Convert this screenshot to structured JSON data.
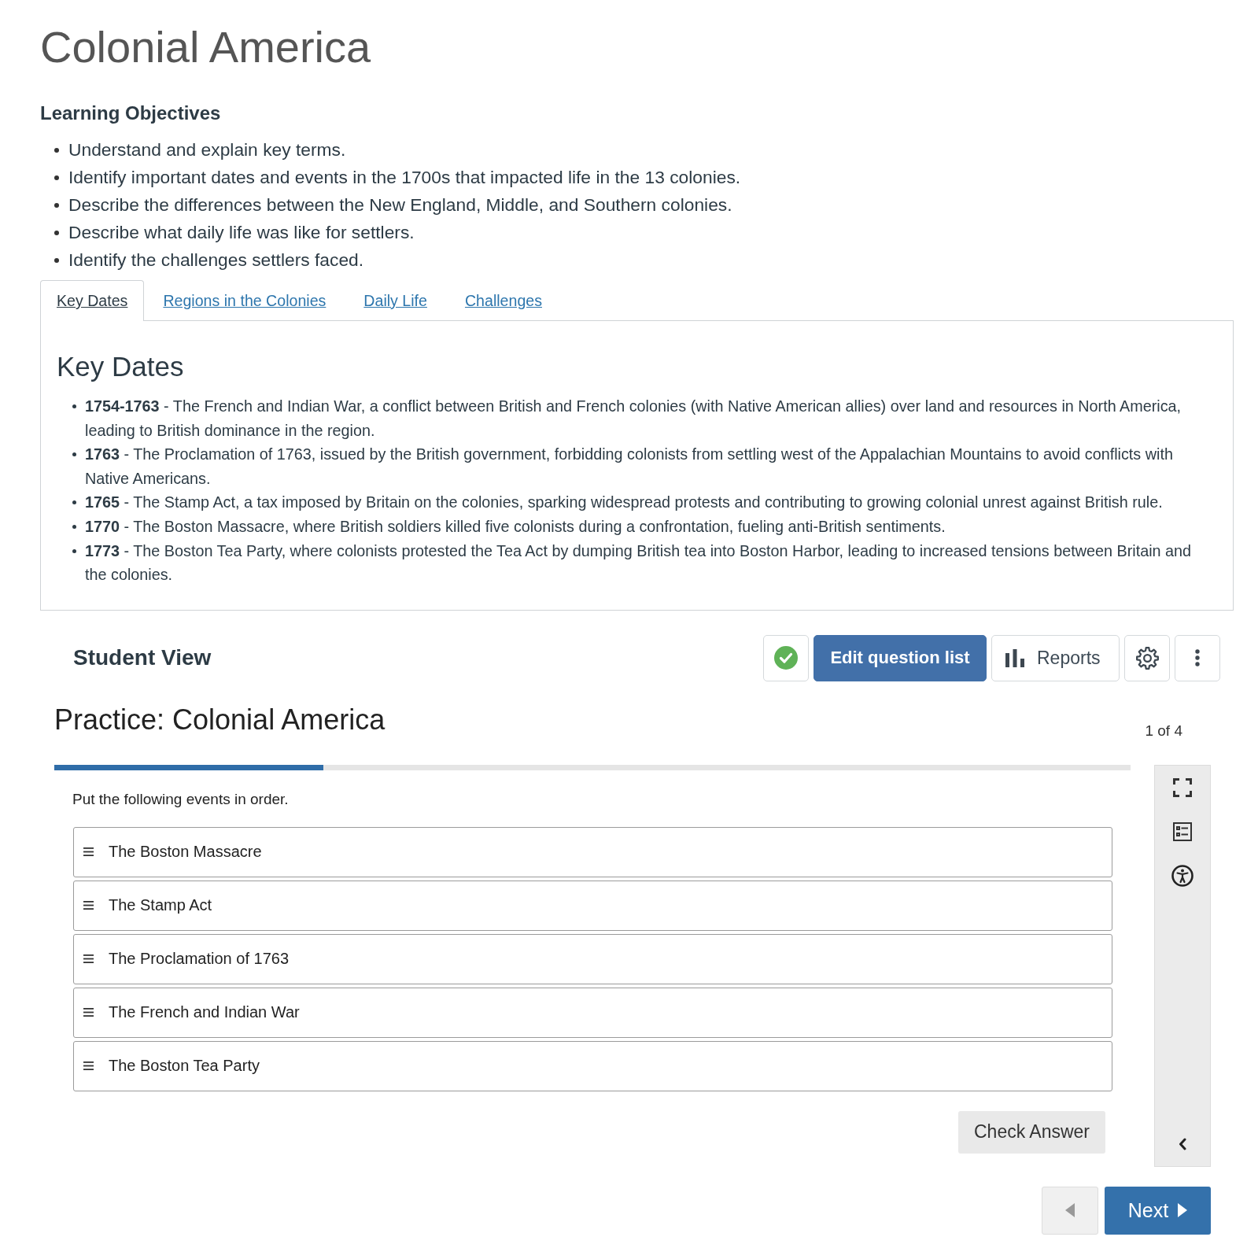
{
  "page": {
    "title": "Colonial America"
  },
  "objectives": {
    "heading": "Learning Objectives",
    "items": [
      "Understand and explain key terms.",
      "Identify important dates and events in the 1700s that impacted life in the 13 colonies.",
      "Describe the differences between the New England, Middle, and Southern colonies.",
      "Describe what daily life was like for settlers.",
      "Identify the challenges settlers faced."
    ]
  },
  "tabs": [
    {
      "label": "Key Dates",
      "selected": true
    },
    {
      "label": "Regions in the Colonies",
      "selected": false
    },
    {
      "label": "Daily Life",
      "selected": false
    },
    {
      "label": "Challenges",
      "selected": false
    }
  ],
  "tab_panel": {
    "heading": "Key Dates",
    "items": [
      "**1754-1763** - The French and Indian War, a conflict between British and French colonies (with Native American allies) over land and resources in North America, leading to British dominance in the region.",
      "**1763** - The Proclamation of 1763, issued by the British government, forbidding colonists from settling west of the Appalachian Mountains to avoid conflicts with Native Americans.",
      "**1765** - The Stamp Act, a tax imposed by Britain on the colonies, sparking widespread protests and contributing to growing colonial unrest against British rule.",
      "**1770** - The Boston Massacre, where British soldiers killed five colonists during a confrontation, fueling anti-British sentiments.",
      "**1773** - The Boston Tea Party, where colonists protested the Tea Act by dumping British tea into Boston Harbor, leading to increased tensions between Britain and the colonies."
    ]
  },
  "student_view": {
    "title": "Student View",
    "buttons": [
      {
        "kind": "status",
        "published": true
      },
      {
        "kind": "primary",
        "label": "Edit question list"
      },
      {
        "kind": "reports",
        "label": "Reports"
      },
      {
        "kind": "settings"
      },
      {
        "kind": "more"
      }
    ]
  },
  "practice": {
    "title": "Practice: Colonial America",
    "counter": "1 of 4",
    "progress": {
      "level": 0.25
    },
    "prompt": "Put the following events in order.",
    "items": [
      "The Boston Massacre",
      "The Stamp Act",
      "The Proclamation of 1763",
      "The French and Indian War",
      "The Boston Tea Party"
    ],
    "check_button": "Check Answer",
    "tools": [
      {
        "kind": "fullscreen"
      },
      {
        "kind": "outline"
      },
      {
        "kind": "accessibility"
      },
      {
        "kind": "collapse"
      }
    ],
    "previous": {
      "disabled": true
    },
    "next": {
      "label": "Next",
      "disabled": false
    }
  }
}
